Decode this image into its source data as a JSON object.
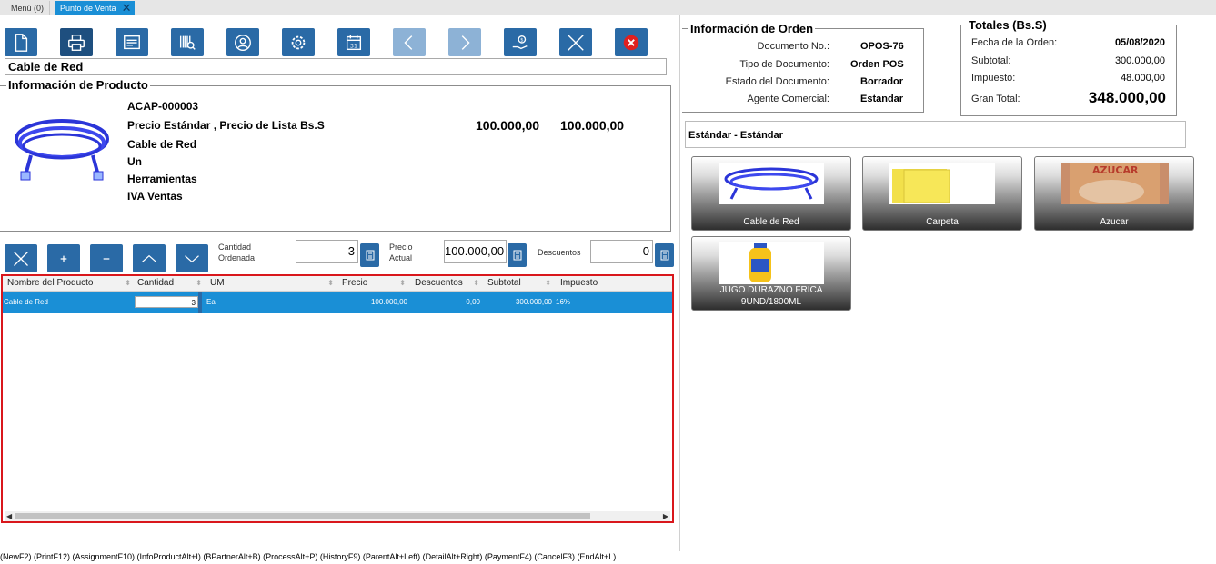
{
  "tabs": [
    {
      "label": "Menú (0)"
    },
    {
      "label": "Punto de Venta"
    }
  ],
  "search": {
    "value": "Cable de Red"
  },
  "product_info": {
    "title": "Información de Producto",
    "code": "ACAP-000003",
    "price_labels": "Precio Estándar , Precio de Lista Bs.S",
    "name": "Cable de Red",
    "uom": "Un",
    "category": "Herramientas",
    "tax": "IVA Ventas",
    "standard_price": "100.000,00",
    "list_price": "100.000,00"
  },
  "controls": {
    "qty_label": "Cantidad Ordenada",
    "qty_value": "3",
    "price_label": "Precio Actual",
    "price_value": "100.000,00",
    "discount_label": "Descuentos",
    "discount_value": "0"
  },
  "grid": {
    "headers": [
      "Nombre del Producto",
      "Cantidad",
      "UM",
      "Precio",
      "Descuentos",
      "Subtotal",
      "Impuesto"
    ],
    "rows": [
      {
        "product": "Cable de Red",
        "qty": "3",
        "uom": "Ea",
        "price": "100.000,00",
        "discount": "0,00",
        "subtotal": "300.000,00",
        "tax": "16%"
      }
    ]
  },
  "order": {
    "title": "Información de Orden",
    "doc_no_label": "Documento No.:",
    "doc_no": "OPOS-76",
    "doc_type_label": "Tipo de Documento:",
    "doc_type": "Orden POS",
    "status_label": "Estado del Documento:",
    "status": "Borrador",
    "agent_label": "Agente Comercial:",
    "agent": "Estandar"
  },
  "totals": {
    "title": "Totales (Bs.S)",
    "date_label": "Fecha de la Orden:",
    "date": "05/08/2020",
    "subtotal_label": "Subtotal:",
    "subtotal": "300.000,00",
    "tax_label": "Impuesto:",
    "tax": "48.000,00",
    "grand_label": "Gran Total:",
    "grand": "348.000,00"
  },
  "price_list": "Estándar - Estándar",
  "quick_products": [
    {
      "name": "Cable de Red"
    },
    {
      "name": "Carpeta"
    },
    {
      "name": "Azucar"
    },
    {
      "name": "JUGO DURAZNO FRICA 9UND/1800ML"
    }
  ],
  "shortcuts": "(NewF2) (PrintF12) (AssignmentF10) (InfoProductAlt+I) (BPartnerAlt+B) (ProcessAlt+P) (HistoryF9) (ParentAlt+Left) (DetailAlt+Right) (PaymentF4) (CancelF3) (EndAlt+L)",
  "colors": {
    "accent": "#1a8fd6",
    "button": "#2a6aa6",
    "grid_border": "#d9171c"
  }
}
